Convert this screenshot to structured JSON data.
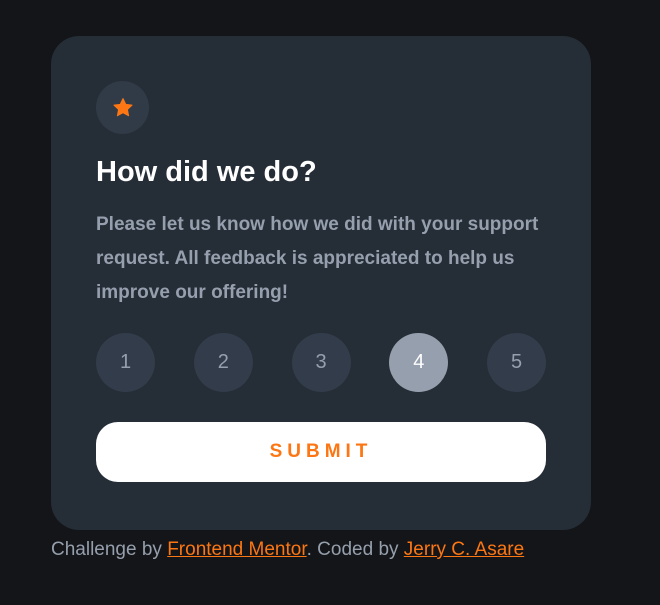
{
  "colors": {
    "background": "#131518",
    "card": "#252d37",
    "icon_circle": "#313b48",
    "rating_circle": "#323c4a",
    "rating_selected": "#969fad",
    "accent": "#fc7614",
    "text_muted": "#969fad",
    "text_heading": "#ffffff"
  },
  "card": {
    "icon": "star-icon",
    "title": "How did we do?",
    "description": "Please let us know how we did with your support request. All feedback is appreciated to help us improve our offering!"
  },
  "ratings": {
    "options": [
      "1",
      "2",
      "3",
      "4",
      "5"
    ],
    "selected": "4"
  },
  "submit": {
    "label": "SUBMIT"
  },
  "attribution": {
    "challenge_prefix": "Challenge by ",
    "challenge_link": "Frontend Mentor",
    "coded_prefix": ". Coded by ",
    "coder_link": "Jerry C. Asare"
  }
}
